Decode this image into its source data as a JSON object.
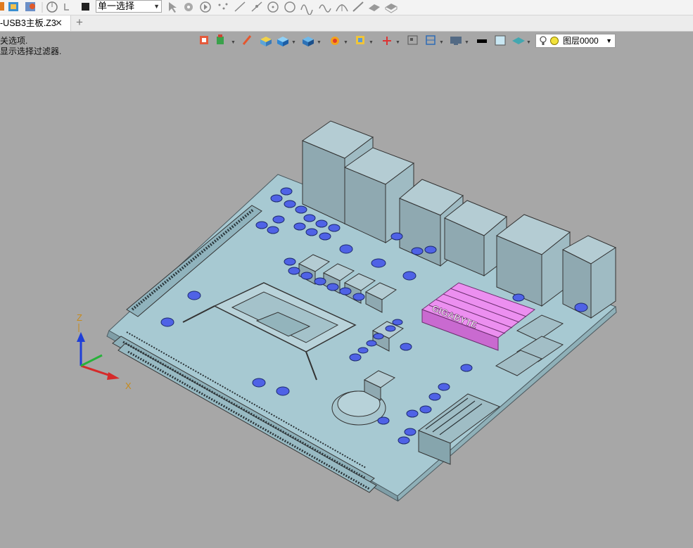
{
  "toolbar": {
    "selection_mode": "单一选择",
    "icons": [
      "shape-icon",
      "image-icon",
      "render-icon",
      "compass-icon",
      "undo-icon",
      "square-icon",
      "cursor-icon",
      "point-filter-icon",
      "play-icon",
      "points-icon",
      "line-icon",
      "pen-icon",
      "circle-select-icon",
      "circle-icon",
      "curve-icon",
      "wave-icon",
      "arc-icon",
      "knife-icon",
      "plane-icon",
      "solid-icon"
    ]
  },
  "tabs": [
    {
      "label": "-USB3主板.Z3",
      "close": "✕"
    }
  ],
  "tab_add": "+",
  "viewport": {
    "hint_line1": "关选项.",
    "hint_line2": "显示选择过滤器."
  },
  "view_toolbar": {
    "icons": [
      "view-exit-icon",
      "paint-icon",
      "pencil-icon",
      "cube-yellow-icon",
      "cube-blue-icon",
      "cube-shaded-icon",
      "sun-icon",
      "frame-icon",
      "axis-icon",
      "grid-icon",
      "section-icon",
      "monitor-icon",
      "black-color-icon",
      "light-blue-color-icon",
      "layer-display-icon"
    ],
    "layer": {
      "name": "图层0000"
    }
  },
  "model": {
    "brand": "GIGABYTE",
    "axes": {
      "z": "Z",
      "x": "X"
    },
    "colors": {
      "board": "#a7c9d2",
      "heatsink": "#ec8ff0",
      "capacitor": "#4f62e6",
      "background": "#a7a7a7"
    }
  }
}
